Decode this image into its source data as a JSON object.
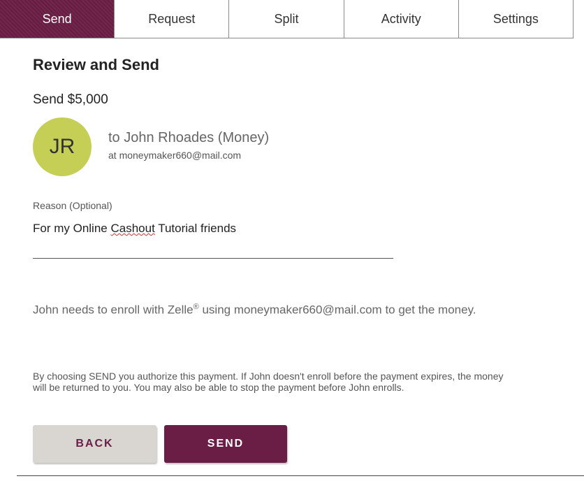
{
  "tabs": [
    {
      "label": "Send",
      "active": true
    },
    {
      "label": "Request",
      "active": false
    },
    {
      "label": "Split",
      "active": false
    },
    {
      "label": "Activity",
      "active": false
    },
    {
      "label": "Settings",
      "active": false
    }
  ],
  "review": {
    "title": "Review and Send",
    "amount_text": "Send $5,000"
  },
  "recipient": {
    "initials": "JR",
    "name_text": "to John Rhoades (Money)",
    "email_text": "at moneymaker660@mail.com"
  },
  "reason": {
    "label": "Reason (Optional)",
    "value_prefix": "For my Online ",
    "value_flagged": "Cashout",
    "value_suffix": " Tutorial friends"
  },
  "notes": {
    "enroll_part1": "John needs to enroll with Zelle",
    "enroll_sup": "®",
    "enroll_part2": " using moneymaker660@mail.com to get the money.",
    "authorization": "By choosing SEND you authorize this payment. If John doesn't enroll before the payment expires, the money will be returned to you. You may also be able to stop the payment before John enrolls."
  },
  "buttons": {
    "back": "BACK",
    "send": "SEND"
  },
  "colors": {
    "brand": "#6b1e45",
    "avatar": "#c5cf55",
    "back_button": "#d9d6d2"
  }
}
